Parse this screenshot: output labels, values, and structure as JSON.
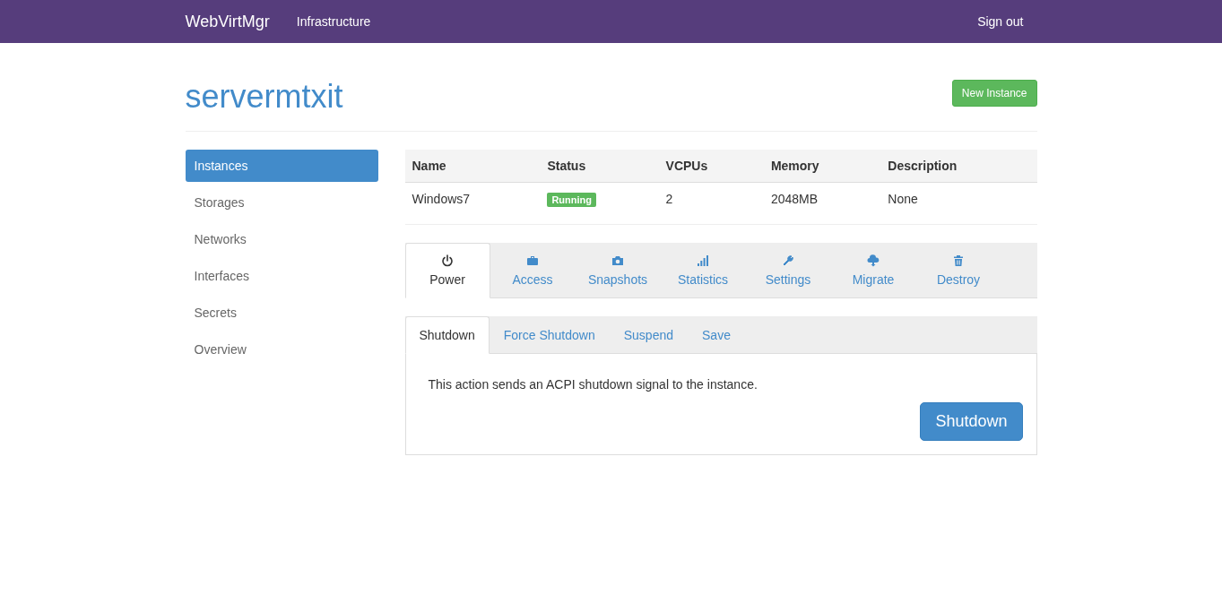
{
  "navbar": {
    "brand": "WebVirtMgr",
    "links": [
      {
        "label": "Infrastructure"
      }
    ],
    "sign_out": "Sign out"
  },
  "page": {
    "title": "servermtxit",
    "new_button": "New Instance"
  },
  "sidebar": {
    "items": [
      {
        "label": "Instances",
        "selected": true
      },
      {
        "label": "Storages",
        "selected": false
      },
      {
        "label": "Networks",
        "selected": false
      },
      {
        "label": "Interfaces",
        "selected": false
      },
      {
        "label": "Secrets",
        "selected": false
      },
      {
        "label": "Overview",
        "selected": false
      }
    ]
  },
  "table": {
    "columns": [
      "Name",
      "Status",
      "VCPUs",
      "Memory",
      "Description"
    ],
    "rows": [
      {
        "name": "Windows7",
        "status": "Running",
        "vcpus": "2",
        "memory": "2048MB",
        "description": "None"
      }
    ]
  },
  "tabs": [
    {
      "label": "Power",
      "selected": true
    },
    {
      "label": "Access",
      "selected": false
    },
    {
      "label": "Snapshots",
      "selected": false
    },
    {
      "label": "Statistics",
      "selected": false
    },
    {
      "label": "Settings",
      "selected": false
    },
    {
      "label": "Migrate",
      "selected": false
    },
    {
      "label": "Destroy",
      "selected": false
    }
  ],
  "subtabs": [
    {
      "label": "Shutdown",
      "selected": true
    },
    {
      "label": "Force Shutdown",
      "selected": false
    },
    {
      "label": "Suspend",
      "selected": false
    },
    {
      "label": "Save",
      "selected": false
    }
  ],
  "panel": {
    "text": "This action sends an ACPI shutdown signal to the instance.",
    "button": "Shutdown"
  }
}
